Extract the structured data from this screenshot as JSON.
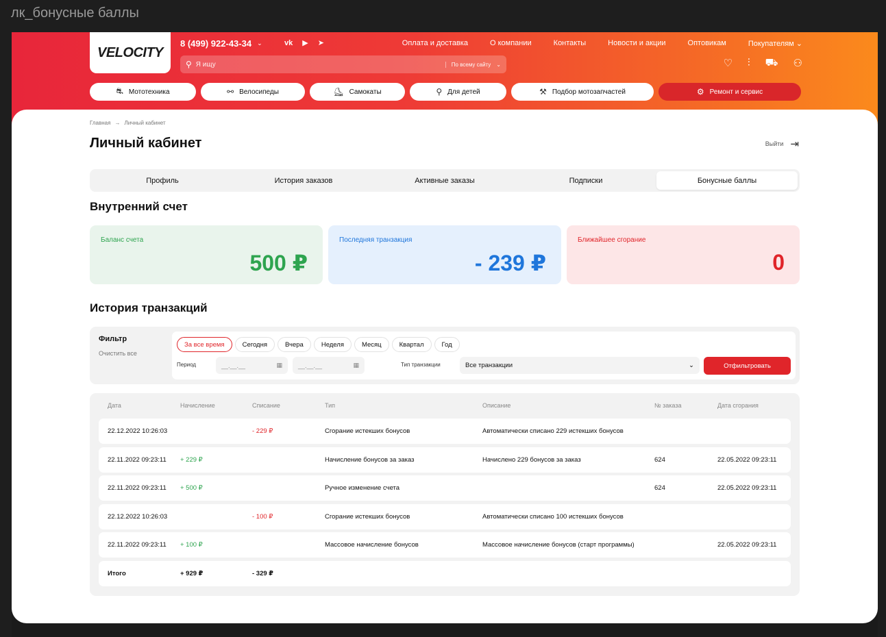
{
  "frame_label": "лк_бонусные баллы",
  "header": {
    "logo": "VELOCITY",
    "phone": "8 (499) 922-43-34",
    "social": [
      "vk-icon",
      "youtube-icon",
      "telegram-icon"
    ],
    "top_nav": [
      "Оплата и доставка",
      "О компании",
      "Контакты",
      "Новости и акции",
      "Оптовикам",
      "Покупателям"
    ],
    "search": {
      "placeholder": "Я ищу",
      "scope": "По всему сайту"
    },
    "icons": [
      "heart-icon",
      "compare-icon",
      "cart-icon",
      "user-icon"
    ],
    "categories": [
      {
        "label": "Мототехника",
        "icon": "motorcycle-icon"
      },
      {
        "label": "Велосипеды",
        "icon": "bicycle-icon"
      },
      {
        "label": "Самокаты",
        "icon": "scooter-icon"
      },
      {
        "label": "Для детей",
        "icon": "kids-bike-icon"
      },
      {
        "label": "Подбор мотозапчастей",
        "icon": "wrench-icon"
      },
      {
        "label": "Ремонт и сервис",
        "icon": "gear-icon"
      }
    ]
  },
  "breadcrumbs": [
    "Главная",
    "Личный кабинет"
  ],
  "page_title": "Личный кабинет",
  "logout_label": "Выйти",
  "tabs": [
    "Профиль",
    "История заказов",
    "Активные заказы",
    "Подписки",
    "Бонусные баллы"
  ],
  "active_tab": "Бонусные баллы",
  "account": {
    "title": "Внутренний счет",
    "balance": {
      "label": "Баланс счета",
      "value": "500 ₽"
    },
    "last_transaction": {
      "label": "Последняя транзакция",
      "value": "- 239 ₽"
    },
    "nearest_expiry": {
      "label": "Ближайшее сгорание",
      "value": "0"
    }
  },
  "history": {
    "title": "История транзакций",
    "filter": {
      "title": "Фильтр",
      "clear": "Очистить все",
      "periods": [
        "За все время",
        "Сегодня",
        "Вчера",
        "Неделя",
        "Месяц",
        "Квартал",
        "Год"
      ],
      "active_period": "За все время",
      "period_label": "Период",
      "date_from_placeholder": "__.__.__",
      "date_to_placeholder": "__.__.__",
      "type_label": "Тип транзакции",
      "type_value": "Все транзакции",
      "submit": "Отфильтровать"
    },
    "columns": [
      "Дата",
      "Начисление",
      "Списание",
      "Тип",
      "Описание",
      "№ заказа",
      "Дата сгорания"
    ],
    "rows": [
      {
        "date": "22.12.2022  10:26:03",
        "accrual": "",
        "writeoff": "- 229 ₽",
        "type": "Сгорание истекших бонусов",
        "description": "Автоматически списано 229 истекших бонусов",
        "order": "",
        "expiry": ""
      },
      {
        "date": "22.11.2022  09:23:11",
        "accrual": "+ 229 ₽",
        "writeoff": "",
        "type": "Начисление бонусов за заказ",
        "description": "Начислено 229 бонусов за заказ",
        "order": "624",
        "expiry": "22.05.2022  09:23:11"
      },
      {
        "date": "22.11.2022  09:23:11",
        "accrual": "+ 500 ₽",
        "writeoff": "",
        "type": "Ручное изменение счета",
        "description": "",
        "order": "624",
        "expiry": "22.05.2022  09:23:11"
      },
      {
        "date": "22.12.2022  10:26:03",
        "accrual": "",
        "writeoff": "- 100 ₽",
        "type": "Сгорание истекших бонусов",
        "description": "Автоматически списано 100 истекших бонусов",
        "order": "",
        "expiry": ""
      },
      {
        "date": "22.11.2022  09:23:11",
        "accrual": "+ 100 ₽",
        "writeoff": "",
        "type": "Массовое начисление бонусов",
        "description": "Массовое начисление бонусов (старт программы)",
        "order": "",
        "expiry": "22.05.2022  09:23:11"
      }
    ],
    "total": {
      "label": "Итого",
      "accrual": "+ 929 ₽",
      "writeoff": "- 329 ₽"
    }
  },
  "colors": {
    "accent_red": "#e0252a",
    "green": "#2ea44f",
    "blue": "#1f76db",
    "header_gradient_start": "#e8263a",
    "header_gradient_end": "#fb8a1c"
  }
}
